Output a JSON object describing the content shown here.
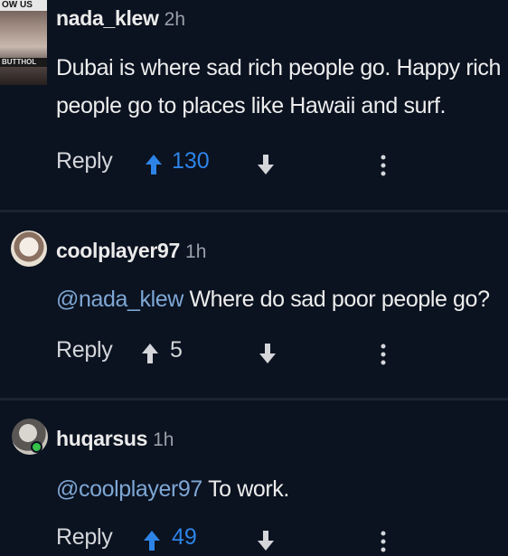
{
  "comments": [
    {
      "username": "nada_klew",
      "time": "2h",
      "body": "Dubai is where sad rich people go. Happy rich people go to places like Hawaii and surf.",
      "reply_label": "Reply",
      "votes": "130",
      "vote_color": "#2d84e6",
      "avatar_text_top": "OW US",
      "avatar_text_mid": "BUTTHOL"
    },
    {
      "username": "coolplayer97",
      "time": "1h",
      "mention": "@nada_klew",
      "body": "Where do sad poor people go?",
      "reply_label": "Reply",
      "votes": "5",
      "vote_color": "#d4d6da"
    },
    {
      "username": "huqarsus",
      "time": "1h",
      "mention": "@coolplayer97",
      "body": "To work.",
      "reply_label": "Reply",
      "votes": "49",
      "vote_color": "#2d84e6"
    }
  ],
  "colors": {
    "background": "#0b1220",
    "mention": "#7ea7d4",
    "upvoted": "#2d84e6",
    "online": "#37c24a"
  },
  "icons": [
    "upvote-arrow-icon",
    "downvote-arrow-icon",
    "more-options-icon"
  ]
}
